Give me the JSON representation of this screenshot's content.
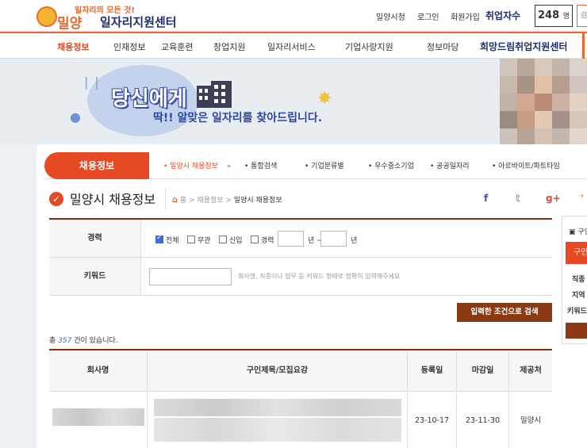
{
  "header": {
    "logo_sub": "일자리의 모든 것!",
    "logo_city": "밀양",
    "logo_center": "일자리지원센터",
    "links": [
      "밀양시청",
      "로그인",
      "회원가입"
    ],
    "employ_label": "취업자수",
    "employ_count": "248",
    "employ_unit": "명",
    "edge_text": "검"
  },
  "nav": {
    "items": [
      "채용정보",
      "인재정보",
      "교육훈련",
      "창업지원",
      "일자리서비스",
      "기업사랑지원",
      "정보마당"
    ],
    "hope_center": "희망드림취업지원센터"
  },
  "banner": {
    "title": "당신에게",
    "subtitle": "딱!! 알맞은 일자리를 찾아드립니다."
  },
  "subnav": {
    "main": "채용정보",
    "items": [
      "밀양시 채용정보",
      "통합검색",
      "기업분류별",
      "우수중소기업",
      "공공일자리",
      "아르바이트/파트타임"
    ]
  },
  "page": {
    "title": "밀양시 채용정보",
    "breadcrumb": [
      "홈",
      "채용정보",
      "밀양시 채용정보"
    ]
  },
  "form": {
    "career_label": "경력",
    "options": [
      "전체",
      "무관",
      "신입",
      "경력"
    ],
    "year_unit": "년 ~",
    "year_unit2": "년",
    "keyword_label": "키워드",
    "keyword_value": "",
    "keyword_hint": "회사명, 직종이나 업무 등 키워드 형태로 정확히 입력해주세요",
    "search_button": "입력한 조건으로 검색"
  },
  "results": {
    "prefix": "총",
    "count": "357",
    "suffix": "건이 있습니다."
  },
  "table": {
    "columns": [
      "회사명",
      "구인제목/모집요강",
      "등록일",
      "마감일",
      "제공처"
    ],
    "rows": [
      {
        "registered": "23-10-17",
        "deadline": "23-11-30",
        "provider": "밀양시"
      }
    ]
  },
  "side": {
    "title": "구인",
    "tab": "구인",
    "labels": [
      "직종",
      "지역",
      "키워드"
    ]
  },
  "colors": {
    "accent": "#e64a24",
    "navy": "#1f2e6b",
    "dark_brown": "#8b3a14",
    "link_blue": "#3b6fd8"
  }
}
